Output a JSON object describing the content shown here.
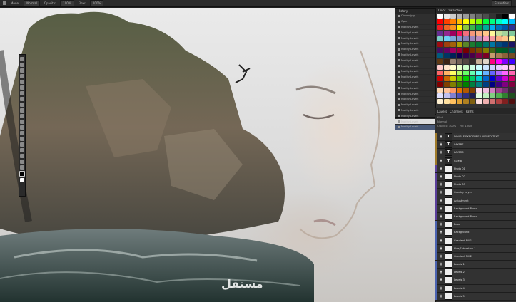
{
  "options_bar": {
    "items": [
      "Mode:",
      "Normal",
      "Opacity:",
      "100%",
      "Flow:",
      "100%"
    ],
    "workspace": "Essentials"
  },
  "history": {
    "title": "History",
    "items": [
      "Clouds.jpg",
      "Open",
      "Modify Levels",
      "Modify Levels",
      "Modify Levels",
      "Modify Levels",
      "Modify Levels",
      "Modify Levels",
      "Modify Levels",
      "Modify Levels",
      "Modify Levels",
      "Modify Levels",
      "Modify Levels",
      "Modify Levels",
      "Modify Levels",
      "Modify Levels",
      "Modify Levels",
      "Modify Levels",
      "Modify Levels",
      "Modify Levels",
      "Modify Levels"
    ],
    "selected_index": 20
  },
  "swatches": {
    "tabs": [
      "Color",
      "Swatches"
    ],
    "colors": [
      "#ffffff",
      "#e6e6e6",
      "#cccccc",
      "#b3b3b3",
      "#999999",
      "#808080",
      "#666666",
      "#4d4d4d",
      "#333333",
      "#1a1a1a",
      "#000000",
      "#ffffff",
      "#ff0000",
      "#ff4000",
      "#ff8000",
      "#ffbf00",
      "#ffff00",
      "#bfff00",
      "#80ff00",
      "#00ff40",
      "#00ff80",
      "#00ffbf",
      "#00ffff",
      "#00bfff",
      "#ed1c24",
      "#f26522",
      "#f7941d",
      "#fff200",
      "#8dc63f",
      "#39b54a",
      "#00a651",
      "#00a99d",
      "#00aeef",
      "#0072bc",
      "#0054a6",
      "#2e3192",
      "#662d91",
      "#92278f",
      "#9e005d",
      "#ed145b",
      "#f26d7d",
      "#f7977a",
      "#fbad82",
      "#fdc689",
      "#fff799",
      "#c4df9b",
      "#a3d39c",
      "#82ca9c",
      "#7accc8",
      "#6dcff6",
      "#7da7d9",
      "#8393ca",
      "#8781bd",
      "#a186be",
      "#bd8cbf",
      "#f49ac1",
      "#f5989d",
      "#f9ad81",
      "#fdc68a",
      "#fff79a",
      "#9e0b0f",
      "#a0410d",
      "#a3620a",
      "#aba000",
      "#598527",
      "#1a7b30",
      "#007236",
      "#00746b",
      "#0076a3",
      "#004a80",
      "#003471",
      "#1b1464",
      "#440e62",
      "#630460",
      "#9e005d",
      "#9e0039",
      "#790000",
      "#7b2e00",
      "#7d4900",
      "#827b00",
      "#406618",
      "#005e20",
      "#005826",
      "#005952",
      "#005b7f",
      "#003663",
      "#002157",
      "#0d004c",
      "#32004b",
      "#4b0049",
      "#7b0046",
      "#7a0026",
      "#c69c6d",
      "#a67c52",
      "#8c6239",
      "#754c24",
      "#603913",
      "#3c2415",
      "#998675",
      "#736357",
      "#534741",
      "#362f2d",
      "#c7b299",
      "#e0d6c8",
      "#ff0080",
      "#ff00ff",
      "#8000ff",
      "#4000ff",
      "#ffcccc",
      "#ffe6cc",
      "#ffffcc",
      "#e6ffcc",
      "#ccffcc",
      "#ccffe6",
      "#ccffff",
      "#cce6ff",
      "#ccccff",
      "#e6ccff",
      "#ffccff",
      "#ffcce6",
      "#ff6666",
      "#ffb366",
      "#ffff66",
      "#b3ff66",
      "#66ff66",
      "#66ffb3",
      "#66ffff",
      "#66b3ff",
      "#6666ff",
      "#b366ff",
      "#ff66ff",
      "#ff66b3",
      "#cc0000",
      "#cc6600",
      "#cccc00",
      "#66cc00",
      "#00cc00",
      "#00cc66",
      "#00cccc",
      "#0066cc",
      "#0000cc",
      "#6600cc",
      "#cc00cc",
      "#cc0066",
      "#800000",
      "#804000",
      "#808000",
      "#408000",
      "#008000",
      "#008040",
      "#008080",
      "#004080",
      "#000080",
      "#400080",
      "#800080",
      "#800040",
      "#ffd9b3",
      "#ffc299",
      "#ff9966",
      "#e67300",
      "#b35900",
      "#804000",
      "#ffe0f0",
      "#f0c0e0",
      "#d080c0",
      "#a04090",
      "#703070",
      "#402040",
      "#e0e0ff",
      "#c0c0f0",
      "#8080d0",
      "#5050b0",
      "#303080",
      "#202050",
      "#e0ffe0",
      "#c0f0c0",
      "#80d080",
      "#50b050",
      "#308030",
      "#205020",
      "#fff0d0",
      "#ffe0a0",
      "#ffc060",
      "#e0a030",
      "#b08020",
      "#806010",
      "#ffe0e0",
      "#f0b0b0",
      "#d07070",
      "#b04040",
      "#802020",
      "#501010"
    ]
  },
  "layers": {
    "tabs": [
      "Layers",
      "Channels",
      "Paths"
    ],
    "kind_label": "Kind",
    "blend": "Normal",
    "opacity": "Opacity: 100%",
    "fill": "Fill: 100%",
    "items": [
      {
        "tag": "#9e7a2a",
        "thumb": "T",
        "name": "DOUBLE EXPOSURE LAYERED TEXT"
      },
      {
        "tag": "#9e7a2a",
        "thumb": "T",
        "name": "LAYERS"
      },
      {
        "tag": "#9e7a2a",
        "thumb": "T",
        "name": "LAYERS"
      },
      {
        "tag": "#9e7a2a",
        "thumb": "T",
        "name": "CLIMB"
      },
      {
        "tag": "#5a3f9a",
        "thumb": "",
        "name": "Photo 01"
      },
      {
        "tag": "#5a3f9a",
        "thumb": "",
        "name": "Photo 02"
      },
      {
        "tag": "#5a3f9a",
        "thumb": "",
        "name": "Photo 03"
      },
      {
        "tag": "#5a3f9a",
        "thumb": "",
        "name": "Overlay Layer"
      },
      {
        "tag": "#5a3f9a",
        "thumb": "",
        "name": "Adjustment"
      },
      {
        "tag": "#5a3f9a",
        "thumb": "",
        "name": "Background Photo"
      },
      {
        "tag": "#5a3f9a",
        "thumb": "",
        "name": "Background Photo"
      },
      {
        "tag": "#4b63b0",
        "thumb": "",
        "name": "Base"
      },
      {
        "tag": "#4b63b0",
        "thumb": "",
        "name": "Background"
      },
      {
        "tag": "#4b63b0",
        "thumb": "",
        "name": "Gradient Fill 1"
      },
      {
        "tag": "#4b63b0",
        "thumb": "",
        "name": "Hue/Saturation 1"
      },
      {
        "tag": "#4b63b0",
        "thumb": "",
        "name": "Gradient Fill 2"
      },
      {
        "tag": "#4b63b0",
        "thumb": "",
        "name": "Levels 1"
      },
      {
        "tag": "#4b63b0",
        "thumb": "",
        "name": "Levels 2"
      },
      {
        "tag": "#4b63b0",
        "thumb": "",
        "name": "Levels 3"
      },
      {
        "tag": "#4b63b0",
        "thumb": "",
        "name": "Levels 4"
      },
      {
        "tag": "#4b63b0",
        "thumb": "",
        "name": "Levels 5"
      }
    ]
  },
  "watermark": "مستقل"
}
